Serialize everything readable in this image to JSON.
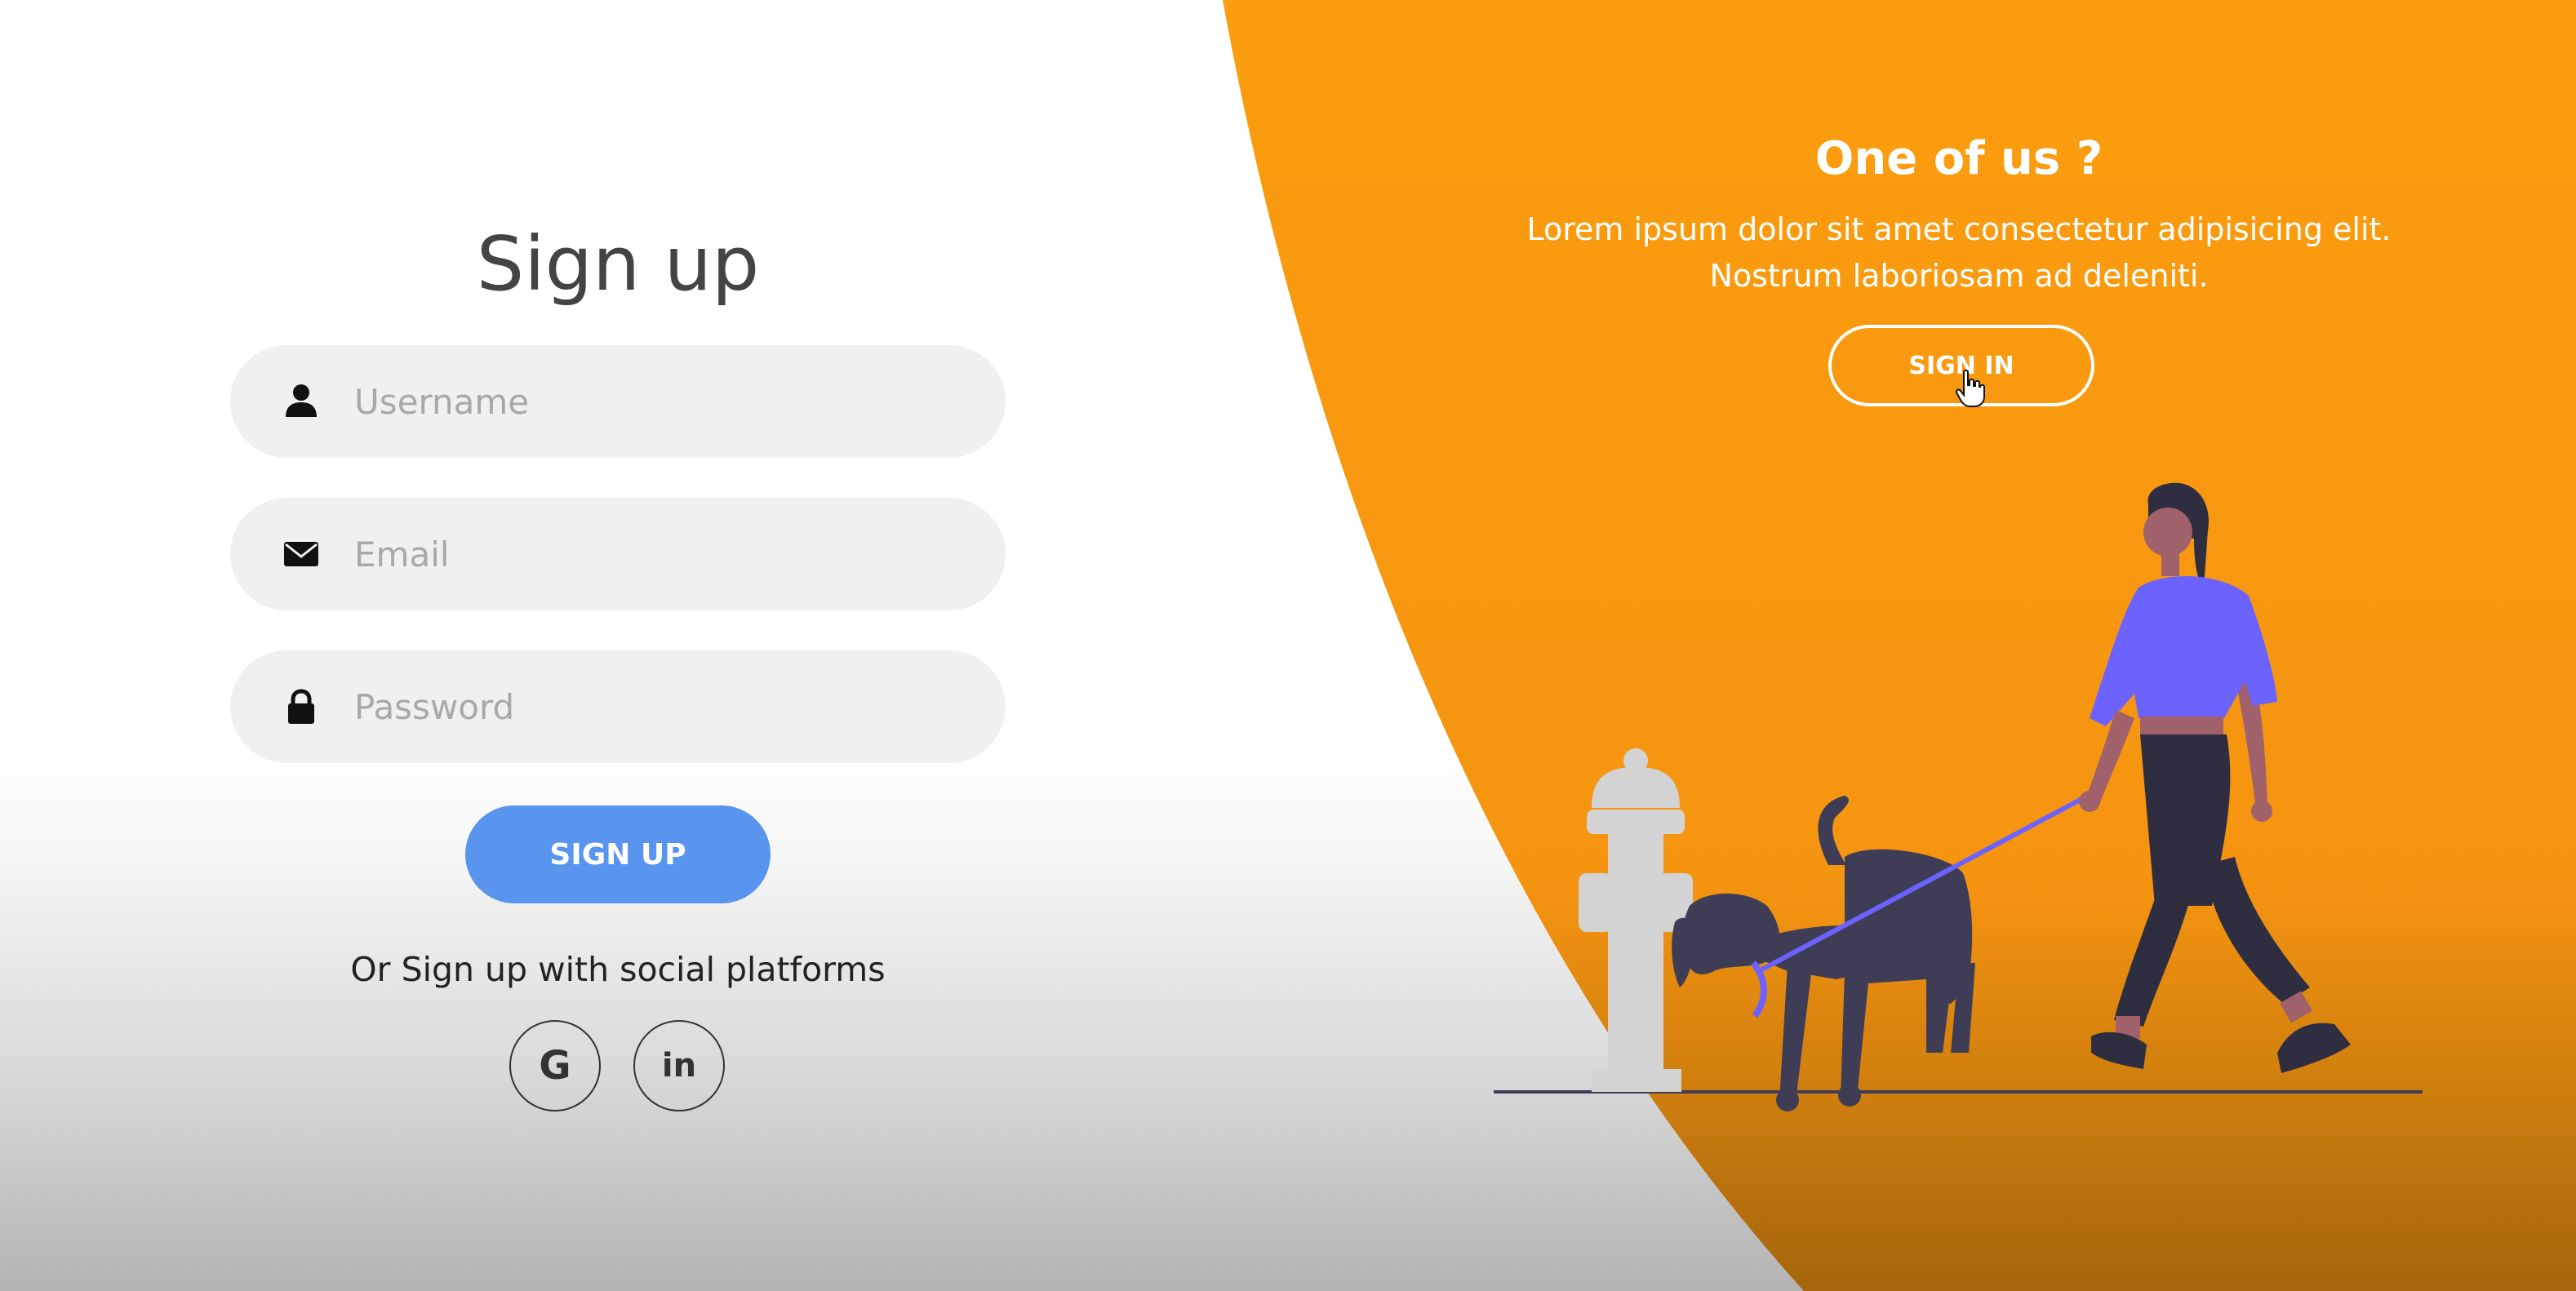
{
  "colors": {
    "accent_orange": "#fb9c10",
    "signup_blue": "#5995ef",
    "shirt_purple": "#6c63ff",
    "figure_dark": "#3f3d56"
  },
  "signup": {
    "title": "Sign up",
    "fields": {
      "username": {
        "placeholder": "Username",
        "value": "",
        "icon": "user-icon"
      },
      "email": {
        "placeholder": "Email",
        "value": "",
        "icon": "envelope-icon"
      },
      "password": {
        "placeholder": "Password",
        "value": "",
        "icon": "lock-icon"
      }
    },
    "button_label": "SIGN UP",
    "social_text": "Or Sign up with social platforms",
    "social": [
      {
        "name": "google",
        "label": "G",
        "icon": "google-icon"
      },
      {
        "name": "linkedin",
        "label": "in",
        "icon": "linkedin-icon"
      }
    ]
  },
  "panel": {
    "title": "One of us ?",
    "text_line1": "Lorem ipsum dolor sit amet consectetur adipisicing elit.",
    "text_line2": "Nostrum laboriosam ad deleniti.",
    "button_label": "SIGN IN",
    "illustration": "woman-walking-dog-illustration"
  }
}
